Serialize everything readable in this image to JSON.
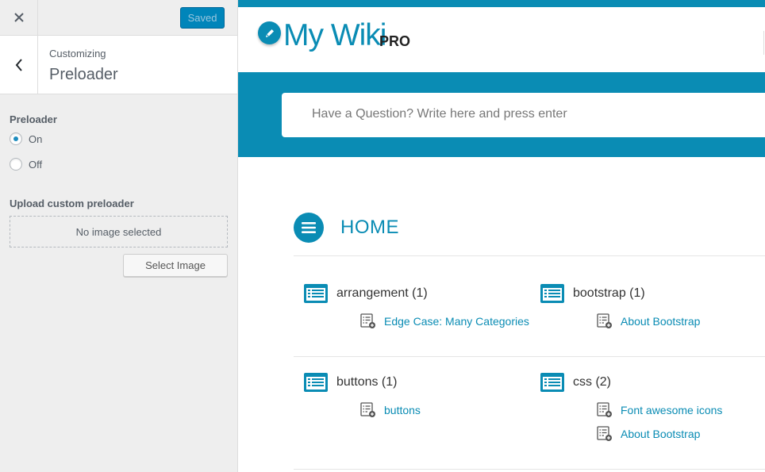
{
  "sidebar": {
    "saved_label": "Saved",
    "breadcrumb": "Customizing",
    "section_title": "Preloader",
    "preloader_label": "Preloader",
    "options": [
      {
        "label": "On",
        "checked": true
      },
      {
        "label": "Off",
        "checked": false
      }
    ],
    "upload_label": "Upload custom preloader",
    "no_image": "No image selected",
    "select_button": "Select Image"
  },
  "site": {
    "logo": "My Wiki",
    "logo_badge": "PRO",
    "search_placeholder": "Have a Question? Write here and press enter",
    "home_title": "HOME",
    "accent_color": "#0a8cb4",
    "categories": [
      {
        "name": "arrangement (1)",
        "posts": [
          "Edge Case: Many Categories"
        ]
      },
      {
        "name": "bootstrap (1)",
        "posts": [
          "About Bootstrap"
        ]
      },
      {
        "name": "buttons (1)",
        "posts": [
          "buttons"
        ]
      },
      {
        "name": "css (2)",
        "posts": [
          "Font awesome icons",
          "About Bootstrap"
        ]
      }
    ]
  }
}
